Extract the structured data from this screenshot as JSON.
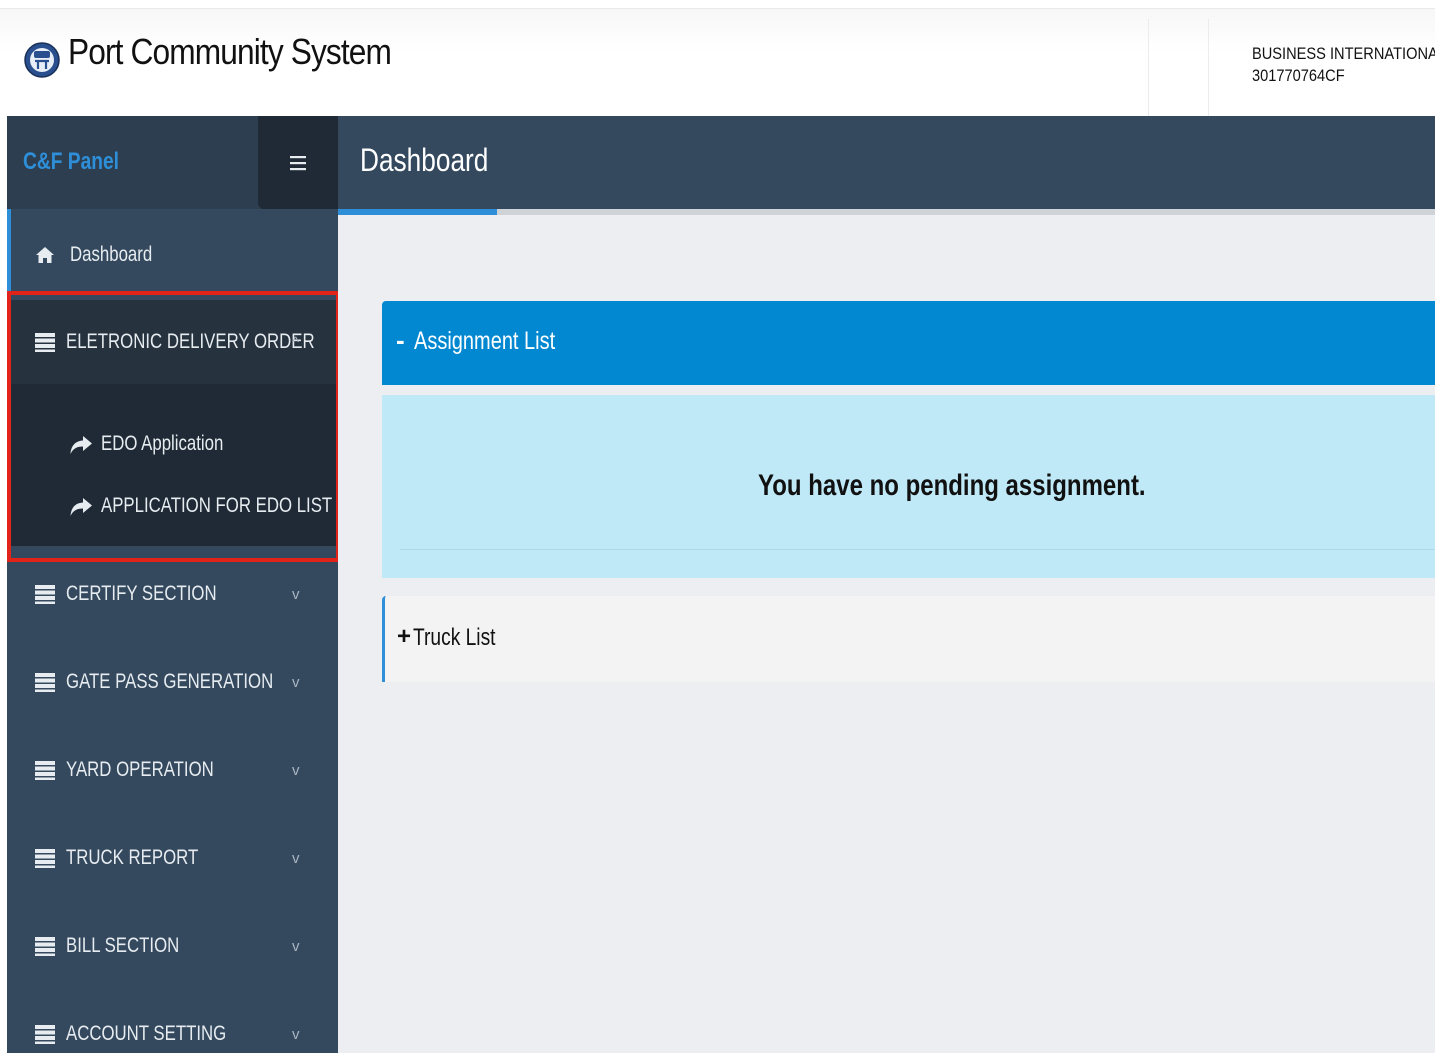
{
  "app": {
    "title": "Port Community System",
    "company_name": "BUSINESS INTERNATIONAL",
    "company_code": "301770764CF"
  },
  "sidebar": {
    "panel_title": "C&F Panel",
    "menu_toggle_icon": "hamburger-icon",
    "items": [
      {
        "label": "Dashboard",
        "icon": "home-icon"
      },
      {
        "label": "ELETRONIC DELIVERY ORDER",
        "icon": "list-icon",
        "chevron": "^",
        "expanded": true,
        "children": [
          {
            "label": "EDO Application",
            "icon": "share-arrow-icon"
          },
          {
            "label": "APPLICATION FOR EDO LIST",
            "icon": "share-arrow-icon"
          }
        ]
      },
      {
        "label": "CERTIFY SECTION",
        "icon": "list-icon",
        "chevron": "v"
      },
      {
        "label": "GATE PASS GENERATION",
        "icon": "list-icon",
        "chevron": "v"
      },
      {
        "label": "YARD OPERATION",
        "icon": "list-icon",
        "chevron": "v"
      },
      {
        "label": "TRUCK REPORT",
        "icon": "list-icon",
        "chevron": "v"
      },
      {
        "label": "BILL SECTION",
        "icon": "list-icon",
        "chevron": "v"
      },
      {
        "label": "ACCOUNT SETTING",
        "icon": "list-icon",
        "chevron": "v"
      }
    ]
  },
  "header": {
    "title": "Dashboard"
  },
  "main": {
    "assignment": {
      "toggle": "-",
      "title": "Assignment List",
      "empty_message": "You have no pending assignment."
    },
    "truck": {
      "toggle": "+",
      "title": "Truck List"
    }
  },
  "colors": {
    "sidebar_bg": "#34495e",
    "accent": "#2e8fd8",
    "assignment_header": "#0288d1",
    "assignment_body": "#c0e9f8",
    "highlight_border": "#e2231a"
  }
}
